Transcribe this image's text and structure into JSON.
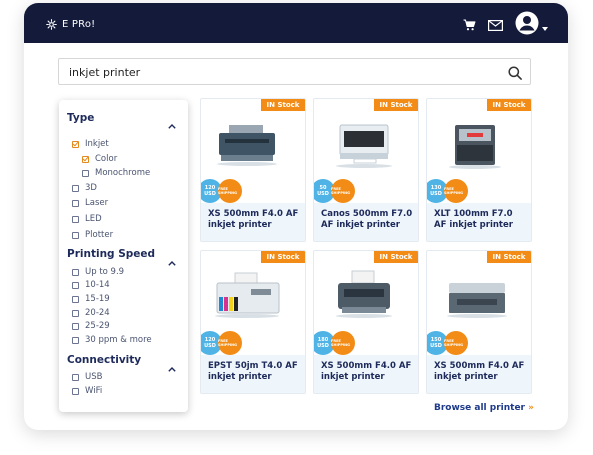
{
  "header": {
    "brand": "E PRo!",
    "icons": [
      "gear-icon",
      "cart-icon",
      "mail-icon",
      "user-avatar-icon",
      "caret-down-icon"
    ]
  },
  "search": {
    "value": "inkjet printer",
    "icon": "search-icon"
  },
  "filters": {
    "type": {
      "title": "Type",
      "options": [
        {
          "label": "Inkjet",
          "checked": true
        },
        {
          "label": "Color",
          "checked": true
        },
        {
          "label": "Monochrome",
          "checked": false
        },
        {
          "label": "3D",
          "checked": false
        },
        {
          "label": "Laser",
          "checked": false
        },
        {
          "label": "LED",
          "checked": false
        },
        {
          "label": "Plotter",
          "checked": false
        }
      ]
    },
    "speed": {
      "title": "Printing Speed",
      "options": [
        {
          "label": "Up to 9.9",
          "checked": false
        },
        {
          "label": "10-14",
          "checked": false
        },
        {
          "label": "15-19",
          "checked": false
        },
        {
          "label": "20-24",
          "checked": false
        },
        {
          "label": "25-29",
          "checked": false
        },
        {
          "label": "30 ppm & more",
          "checked": false
        }
      ]
    },
    "connectivity": {
      "title": "Connectivity",
      "options": [
        {
          "label": "USB",
          "checked": false
        },
        {
          "label": "WiFi",
          "checked": false
        }
      ]
    }
  },
  "products": [
    {
      "badge": "IN Stock",
      "name": "XS 500mm F4.0 AF inkjet printer",
      "price_amount": "120",
      "price_currency": "USD",
      "shipping": "FREE SHIPPING"
    },
    {
      "badge": "IN Stock",
      "name": "Canos 500mm F7.0 AF inkjet printer",
      "price_amount": "50",
      "price_currency": "USD",
      "shipping": "FREE SHIPPING"
    },
    {
      "badge": "IN Stock",
      "name": "XLT 100mm F7.0 AF inkjet printer",
      "price_amount": "130",
      "price_currency": "USD",
      "shipping": "FREE SHIPPING"
    },
    {
      "badge": "IN Stock",
      "name": "EPST 50jm T4.0 AF inkjet printer",
      "price_amount": "120",
      "price_currency": "USD",
      "shipping": "FREE SHIPPING"
    },
    {
      "badge": "IN Stock",
      "name": "XS 500mm F4.0 AF inkjet printer",
      "price_amount": "180",
      "price_currency": "USD",
      "shipping": "FREE SHIPPING"
    },
    {
      "badge": "IN Stock",
      "name": "XS 500mm F4.0 AF inkjet printer",
      "price_amount": "150",
      "price_currency": "USD",
      "shipping": "FREE SHIPPING"
    }
  ],
  "browse": {
    "label": "Browse all printer",
    "arrow": "»"
  },
  "colors": {
    "header_bg": "#141a3a",
    "accent_orange": "#f28c16",
    "price_blue": "#4fb3e6",
    "title_navy": "#1d2a5a"
  }
}
